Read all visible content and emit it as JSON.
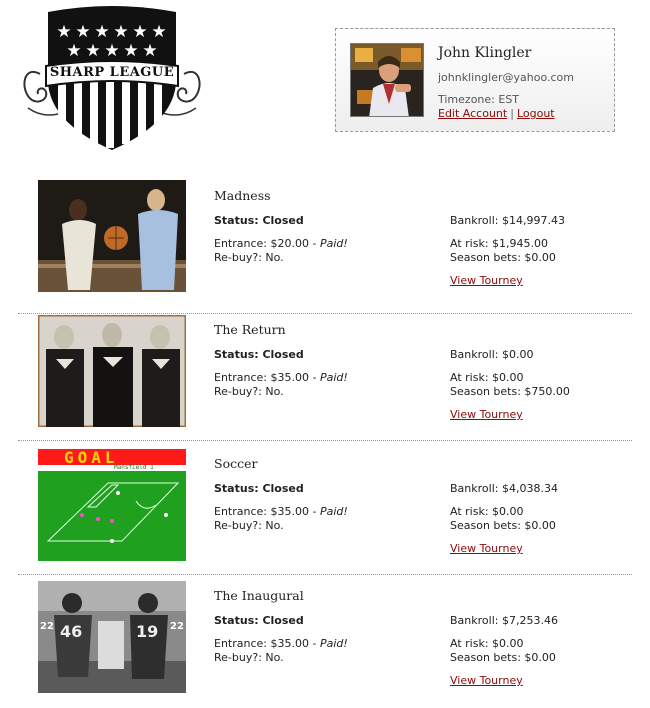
{
  "logo": {
    "text": "SHARP LEAGUE"
  },
  "account": {
    "name": "John Klingler",
    "email": "johnklingler@yahoo.com",
    "timezone": "Timezone: EST",
    "edit_label": "Edit Account",
    "separator": "|",
    "logout_label": "Logout"
  },
  "tourneys": [
    {
      "name": "Madness",
      "status": "Status: Closed",
      "entrance": "Entrance: $20.00",
      "paid": "Paid!",
      "rebuy": "Re-buy?: No.",
      "bankroll": "Bankroll: $14,997.43",
      "at_risk": "At risk: $1,945.00",
      "season_bets": "Season bets: $0.00",
      "view_label": "View Tourney"
    },
    {
      "name": "The Return",
      "status": "Status: Closed",
      "entrance": "Entrance: $35.00",
      "paid": "Paid!",
      "rebuy": "Re-buy?: No.",
      "bankroll": "Bankroll: $0.00",
      "at_risk": "At risk: $0.00",
      "season_bets": "Season bets: $750.00",
      "view_label": "View Tourney"
    },
    {
      "name": "Soccer",
      "status": "Status: Closed",
      "entrance": "Entrance: $35.00",
      "paid": "Paid!",
      "rebuy": "Re-buy?: No.",
      "bankroll": "Bankroll: $4,038.34",
      "at_risk": "At risk: $0.00",
      "season_bets": "Season bets: $0.00",
      "view_label": "View Tourney",
      "thumb_text": "GOAL",
      "thumb_subtext": "Mansfield 1"
    },
    {
      "name": "The Inaugural",
      "status": "Status: Closed",
      "entrance": "Entrance: $35.00",
      "paid": "Paid!",
      "rebuy": "Re-buy?: No.",
      "bankroll": "Bankroll: $7,253.46",
      "at_risk": "At risk: $0.00",
      "season_bets": "Season bets: $0.00",
      "view_label": "View Tourney"
    }
  ],
  "colors": {
    "link": "#8b0a0a",
    "goal_banner": "#ff1a1a",
    "goal_text": "#ffd400",
    "pitch": "#1fa01f"
  }
}
